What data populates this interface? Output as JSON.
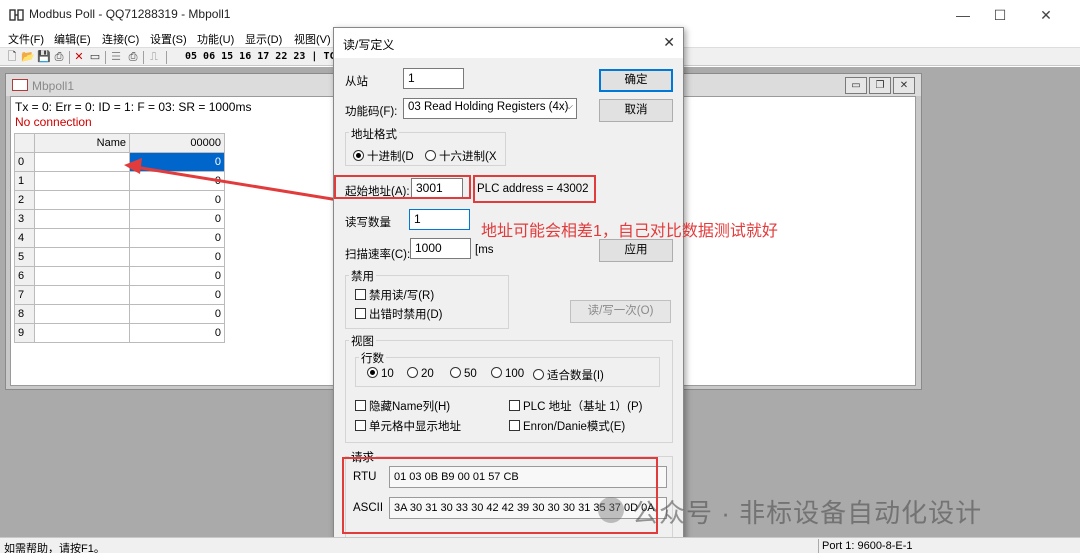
{
  "window": {
    "title": "Modbus Poll - QQ71288319 - Mbpoll1",
    "minimize": "—",
    "maximize": "☐",
    "close": "✕"
  },
  "menu": [
    "文件(F)",
    "编辑(E)",
    "连接(C)",
    "设置(S)",
    "功能(U)",
    "显示(D)",
    "视图(V)"
  ],
  "toolbar": {
    "codes": "05 06 15 16 17 22 23 | TC"
  },
  "child": {
    "title": "Mbpoll1",
    "status": "Tx = 0: Err = 0: ID = 1: F = 03: SR = 1000ms",
    "connection": "No connection",
    "columns": {
      "name": "Name",
      "value": "00000"
    },
    "rows": [
      {
        "idx": "0",
        "value": "0"
      },
      {
        "idx": "1",
        "value": "0"
      },
      {
        "idx": "2",
        "value": "0"
      },
      {
        "idx": "3",
        "value": "0"
      },
      {
        "idx": "4",
        "value": "0"
      },
      {
        "idx": "5",
        "value": "0"
      },
      {
        "idx": "6",
        "value": "0"
      },
      {
        "idx": "7",
        "value": "0"
      },
      {
        "idx": "8",
        "value": "0"
      },
      {
        "idx": "9",
        "value": "0"
      }
    ]
  },
  "dialog": {
    "title": "读/写定义",
    "slave_label": "从站",
    "slave_value": "1",
    "ok": "确定",
    "cancel": "取消",
    "function_label": "功能码(F):",
    "function_value": "03 Read Holding Registers (4x)",
    "addr_format_label": "地址格式",
    "decimal": "十进制(D",
    "hex": "十六进制(X",
    "start_label": "起始地址(A):",
    "start_value": "3001",
    "plc_address": "PLC address = 43002",
    "quantity_label": "读写数量",
    "quantity_value": "1",
    "scan_label": "扫描速率(C):",
    "scan_value": "1000",
    "scan_unit": "[ms",
    "apply": "应用",
    "disable_label": "禁用",
    "disable_rw": "禁用读/写(R)",
    "disable_on_error": "出错时禁用(D)",
    "read_write_once": "读/写一次(O)",
    "view_label": "视图",
    "rows_label": "行数",
    "row_options": [
      "10",
      "20",
      "50",
      "100",
      "适合数量(I)"
    ],
    "hide_name": "隐藏Name列(H)",
    "plc_base1": "PLC 地址（基址 1）(P)",
    "show_addr": "单元格中显示地址",
    "enron": "Enron/Danie模式(E)",
    "request_label": "请求",
    "rtu_label": "RTU",
    "rtu_value": "01 03 0B B9 00 01 57 CB",
    "ascii_label": "ASCII",
    "ascii_value": "3A 30 31 30 33 30 42 42 39 30 30 30 31 35 37 0D 0A"
  },
  "annotation": "地址可能会相差1，自己对比数据测试就好",
  "watermark": "公众号 · 非标设备自动化设计",
  "statusbar": {
    "help": "如需帮助，请按F1。",
    "port": "Port 1: 9600-8-E-1"
  },
  "colors": {
    "accent_red": "#e23b3b",
    "selection": "#0066cc"
  }
}
